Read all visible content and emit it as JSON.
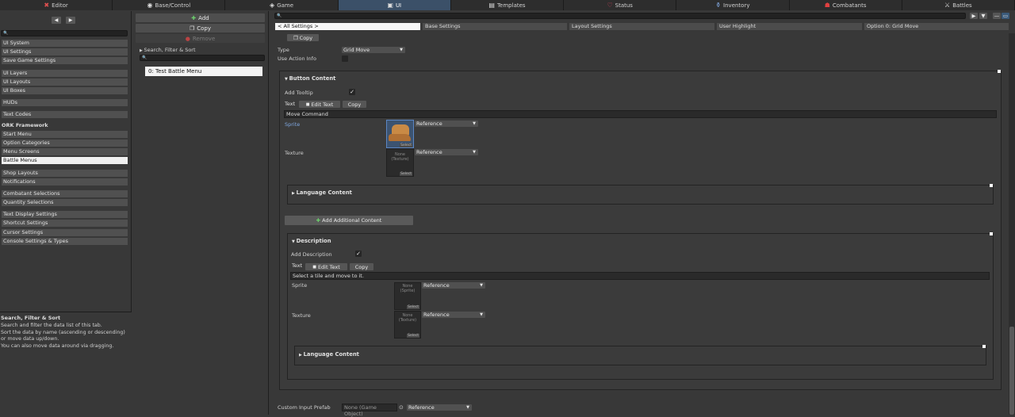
{
  "top_tabs": [
    {
      "label": "Editor",
      "icon": "tools-icon",
      "name": "tab-editor"
    },
    {
      "label": "Base/Control",
      "icon": "gamepad-icon",
      "name": "tab-base-control"
    },
    {
      "label": "Game",
      "icon": "cube-icon",
      "name": "tab-game"
    },
    {
      "label": "UI",
      "icon": "window-icon",
      "name": "tab-ui"
    },
    {
      "label": "Templates",
      "icon": "document-icon",
      "name": "tab-templates"
    },
    {
      "label": "Status",
      "icon": "heart-icon",
      "name": "tab-status"
    },
    {
      "label": "Inventory",
      "icon": "potion-icon",
      "name": "tab-inventory"
    },
    {
      "label": "Combatants",
      "icon": "combatant-icon",
      "name": "tab-combatants"
    },
    {
      "label": "Battles",
      "icon": "swords-icon",
      "name": "tab-battles"
    }
  ],
  "active_tab": "UI",
  "sidebar": {
    "items": [
      "UI System",
      "UI Settings",
      "Save Game Settings",
      "UI Layers",
      "UI Layouts",
      "UI Boxes",
      "HUDs",
      "Text Codes"
    ],
    "group_header": "ORK Framework",
    "items2": [
      "Start Menu",
      "Option Categories",
      "Menu Screens",
      "Battle Menus",
      "Shop Layouts",
      "Notifications",
      "Combatant Selections",
      "Quantity Selections",
      "Text Display Settings",
      "Shortcut Settings",
      "Cursor Settings",
      "Console Settings & Types"
    ],
    "selected": "Battle Menus",
    "help_title": "Search, Filter & Sort",
    "help_lines": [
      "Search and filter the data list of this tab.",
      "Sort the data by name (ascending or descending)",
      "or move data up/down.",
      "You can also move data around via dragging."
    ]
  },
  "list_panel": {
    "add": "Add",
    "copy": "Copy",
    "remove": "Remove",
    "search_filter": "Search, Filter & Sort",
    "items": [
      "0: Test Battle Menu"
    ]
  },
  "section_tabs": [
    "< All Settings >",
    "Base Settings",
    "Layout Settings",
    "User Highlight",
    "Option 0: Grid Move"
  ],
  "editor": {
    "copy_label": "Copy",
    "type_label": "Type",
    "type_value": "Grid Move",
    "use_action_info": "Use Action Info",
    "button_content": {
      "title": "Button Content",
      "add_tooltip": "Add Tooltip",
      "text_label": "Text",
      "edit_text": "Edit Text",
      "copy": "Copy",
      "text_value": "Move Command",
      "sprite": "Sprite",
      "sprite_select": "Select",
      "sprite_mode": "Reference",
      "texture": "Texture",
      "texture_none": "None (Texture)",
      "texture_select": "Select",
      "texture_mode": "Reference",
      "language_content": "Language Content"
    },
    "add_additional_content": "Add Additional Content",
    "description": {
      "title": "Description",
      "add_description": "Add Description",
      "text_label": "Text",
      "edit_text": "Edit Text",
      "copy": "Copy",
      "text_value": "Select a tile and move to it.",
      "sprite": "Sprite",
      "sprite_none": "None (Sprite)",
      "sprite_select": "Select",
      "sprite_mode": "Reference",
      "texture": "Texture",
      "texture_none": "None (Texture)",
      "texture_select": "Select",
      "texture_mode": "Reference",
      "language_content": "Language Content"
    },
    "custom_input_prefab": "Custom Input Prefab",
    "prefab_value": "None (Game Object)",
    "prefab_mode": "Reference"
  },
  "colors": {
    "accent": "#3b5068",
    "sprite_link": "#7fa7e0",
    "boot": "#c98a45"
  }
}
